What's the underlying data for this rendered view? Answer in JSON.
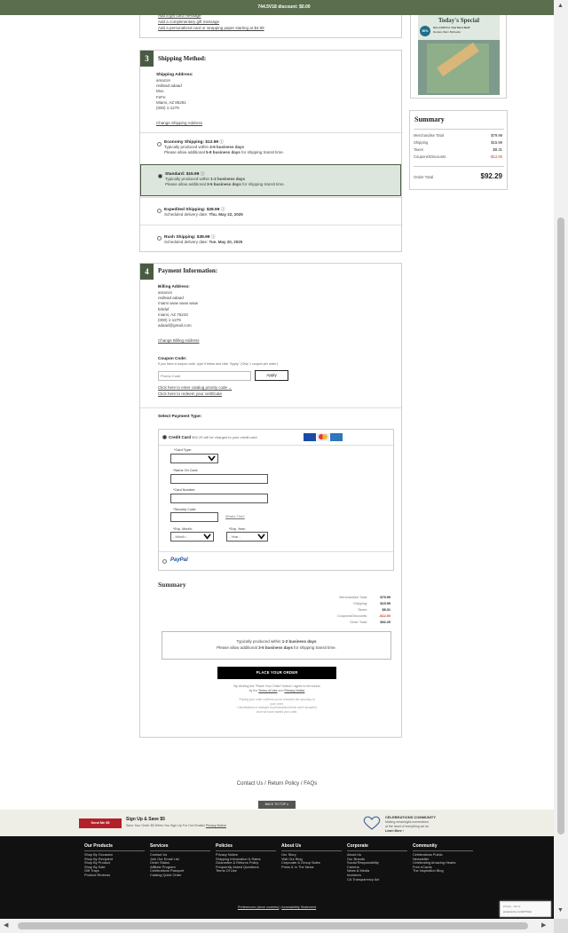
{
  "topbar": {
    "text": "744.5V18 discount: $0.00"
  },
  "gift_options": {
    "line1": "Add a gift card message",
    "line2": "Add a complimentary gift message",
    "line3": "Add a personalized card or wrapping paper starting at $4.99"
  },
  "promo": {
    "title": "Today's Special",
    "badge": "50%",
    "lines": [
      "Get a Gift For Your Best Bud!",
      "Reclaim Barn Birdseller"
    ]
  },
  "side_summary": {
    "title": "Summary",
    "rows": [
      {
        "label": "Merchandise Total",
        "value": "$79.99",
        "neg": false
      },
      {
        "label": "Shipping",
        "value": "$15.99",
        "neg": false
      },
      {
        "label": "Taxes",
        "value": "$8.31",
        "neg": false
      },
      {
        "label": "Coupons/Discounts",
        "value": "-$12.00",
        "neg": true
      }
    ],
    "total_label": "Order Total",
    "total_value": "$92.29"
  },
  "shipping": {
    "num": "3",
    "title": "Shipping Method:",
    "addr_label": "Shipping Address:",
    "addr_lines": [
      "amazon",
      "redlead adaad",
      "Mvu",
      "FeFe",
      "Miami, AZ 85281",
      "(000) 1-1279"
    ],
    "change_link": "Change Shipping Address",
    "options": [
      {
        "name": "Economy Shipping: $12.99",
        "line1a": "Typically produced within ",
        "line1b": "4-6 business days",
        "line2a": "Please allow additional ",
        "line2b": "5-8 business days",
        "line2c": " for shipping transit time.",
        "selected": false
      },
      {
        "name": "Standard: $15.99",
        "line1a": "Typically produced within ",
        "line1b": "1-2 business days",
        "line2a": "Please allow additional ",
        "line2b": "3-5 business days",
        "line2c": " for shipping transit time.",
        "selected": true
      },
      {
        "name": "Expedited Shipping: $28.99",
        "line1a": "Scheduled delivery date: ",
        "line1b": "Thu. May 22, 2025",
        "selected": false
      },
      {
        "name": "Rush Shipping: $38.99",
        "line1a": "Scheduled delivery date: ",
        "line1b": "Tue. May 20, 2025",
        "selected": false
      }
    ]
  },
  "payment": {
    "num": "4",
    "title": "Payment Information:",
    "bill_label": "Billing Address:",
    "bill_lines": [
      "amazon",
      "redlead adaad",
      "miami www www www",
      "fefefef",
      "miami, AZ 75243",
      "(000) 1-1279",
      "adaad@gmail.com"
    ],
    "change_link": "Change Billing Address",
    "coupon_label": "Coupon Code:",
    "coupon_help": "If you have a coupon code, type it below and click \"Apply.\" (Only 1 coupon per order.)",
    "coupon_placeholder": "Promo Code",
    "apply_label": "Apply",
    "catalog_link": "Click here to enter catalog priority code",
    "cert_link": "Click here to redeem your certificate",
    "select_type_label": "Select Payment Type:",
    "credit_label": "Credit Card",
    "credit_note": "$92.29 will be charged to your credit card.",
    "card_type_label": "*Card Type:",
    "name_label": "*Name On Card:",
    "number_label": "*Card Number:",
    "security_label": "*Security Code:",
    "whats_this": "What's This?",
    "exp_month_label": "*Exp. Month:",
    "exp_month_value": "- Month -",
    "exp_year_label": "*Exp. Year:",
    "exp_year_value": "- Year -",
    "paypal": "PayPal"
  },
  "bottom_summary": {
    "title": "Summary",
    "rows": [
      {
        "label": "Merchandise Total:",
        "value": "$79.99",
        "neg": false
      },
      {
        "label": "Shipping:",
        "value": "$15.99",
        "neg": false
      },
      {
        "label": "Taxes:",
        "value": "$8.31",
        "neg": false
      },
      {
        "label": "Coupons/Discounts:",
        "value": "-$12.00",
        "neg": true
      },
      {
        "label": "Order Total:",
        "value": "$92.29",
        "neg": false
      }
    ],
    "note_line1a": "Typically produced within ",
    "note_line1b": "1-2 business days",
    "note_line2a": "Please allow additional ",
    "note_line2b": "3-5 business days",
    "note_line2c": " for shipping transit time.",
    "place_order": "PLACE YOUR ORDER",
    "terms_a": "By clicking the \"Place Your Order\" button I agree to be bound",
    "terms_b": "by the ",
    "terms_link1": "Terms of Use",
    "terms_and": " and ",
    "terms_link2": "Privacy Notice",
    "fine1": "Placing your order confirms you've reviewed the accuracy of",
    "fine2": "your order.",
    "fine3": "Cancellations or changes to personalized items aren't accepted",
    "fine4": "once we have started your order."
  },
  "links": {
    "contact": "Contact Us",
    "sep1": " / ",
    "returns": "Return Policy",
    "sep2": " / ",
    "faqs": "FAQs"
  },
  "back_to_top": "BACK TO TOP ∧",
  "signup": {
    "button": "Send Me $5",
    "title": "Sign Up & Save $5",
    "text": "Save Your Order $5 When You Sign Up For Our Emails!",
    "link": "Privacy Notice"
  },
  "community": {
    "title": "CELEBRATIONS COMMUNITY",
    "line1": "Making meaningful connections",
    "line2": "at the heart of everything we do",
    "learn": "Learn More"
  },
  "footer": [
    {
      "heading": "Our Products",
      "items": [
        "Shop By Occasion",
        "Shop By Recipient",
        "Shop By Product",
        "Shop By Sale",
        "Gift Trays",
        "Product Reviews"
      ]
    },
    {
      "heading": "Services",
      "items": [
        "Contact Us",
        "Join Our Email List",
        "Order Status",
        "Affiliate Program",
        "Celebrations Passport",
        "Catalog Quick Order"
      ]
    },
    {
      "heading": "Policies",
      "items": [
        "Privacy Notice",
        "Shipping Information & Rates",
        "Guarantee & Returns Policy",
        "Frequently Asked Questions",
        "Terms Of Use"
      ]
    },
    {
      "heading": "About Us",
      "items": [
        "Our Story",
        "Visit Our Blog",
        "Corporate & Group Sales",
        "Press & In The News"
      ]
    },
    {
      "heading": "Corporate",
      "items": [
        "About Us",
        "Our Brands",
        "Social Responsibility",
        "Careers",
        "News & Media",
        "Investors",
        "CA Transparency Act"
      ]
    },
    {
      "heading": "Community",
      "items": [
        "Celebrations Public",
        "Newsletter",
        "Celebrating Amazing Hearts",
        "Free eCards",
        "The Inspiration Blog"
      ]
    }
  ],
  "bottom_links": {
    "prefs": "Preferences (store cookies)",
    "sep": " | ",
    "access": "Accessibility Statement"
  },
  "recaptcha": {
    "line1": "Privacy - Terms",
    "line2": "protected by reCAPTCHA"
  }
}
